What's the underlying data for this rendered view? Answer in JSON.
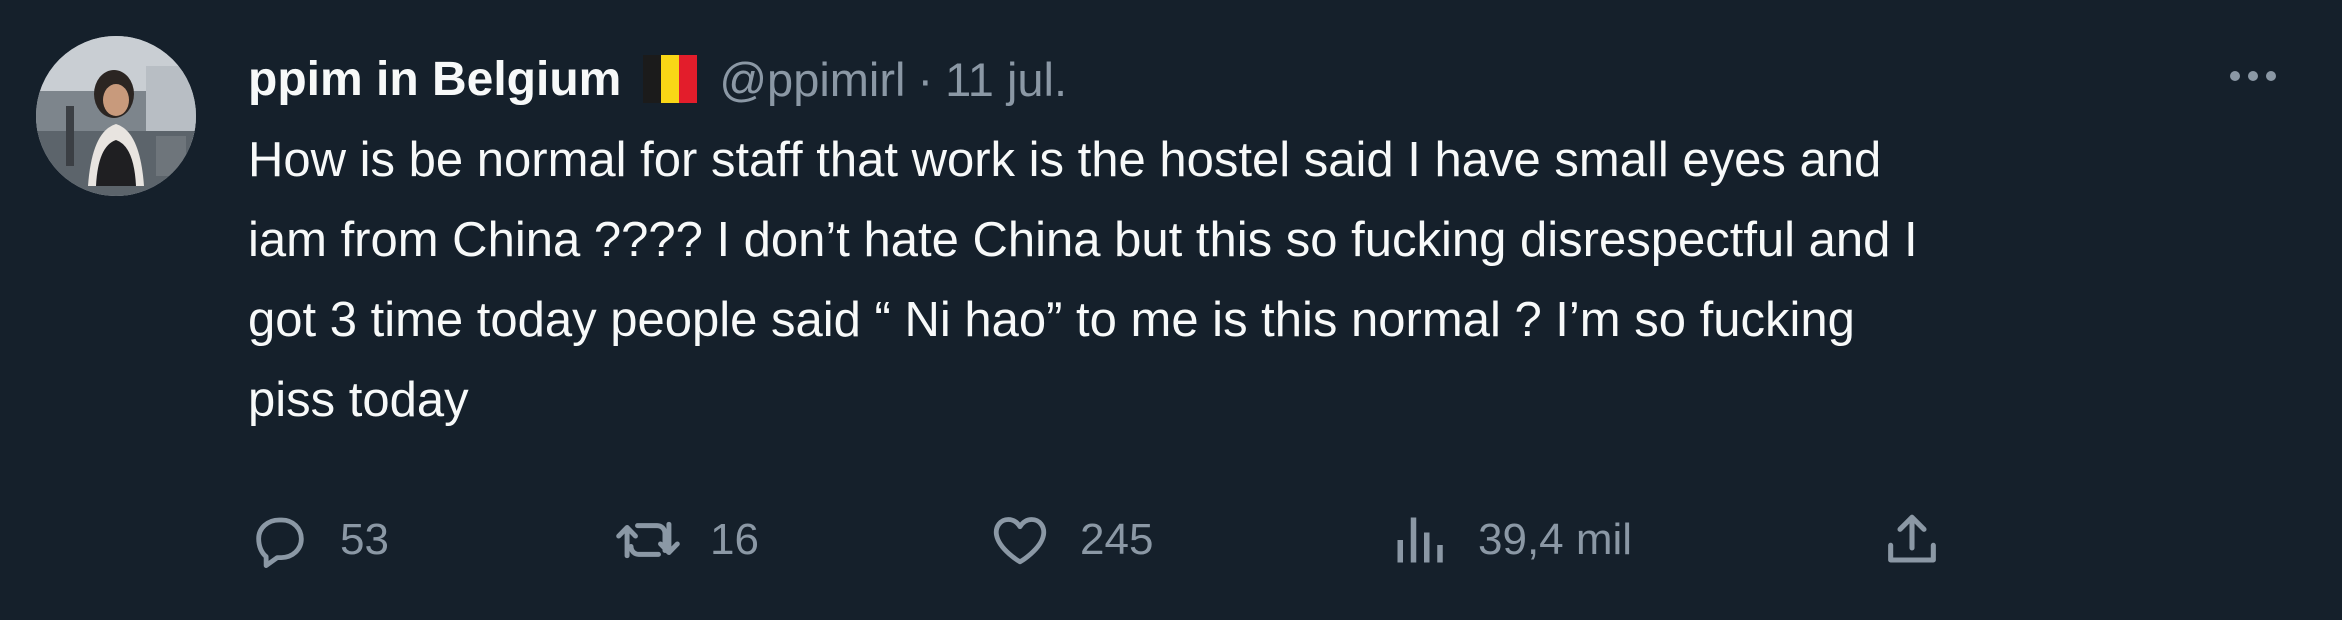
{
  "author": {
    "display_name": "ppim in Belgium",
    "flag_icon": "belgium-flag-icon",
    "flag_colors": [
      "#1b1b1b",
      "#f9d616",
      "#e31d2b"
    ],
    "handle": "@ppimirl",
    "separator": "·",
    "date": "11 jul."
  },
  "tweet": {
    "lines": [
      "How is be normal for staff that work is the hostel said I have small eyes and",
      "iam from China ???? I don’t hate China but this so fucking disrespectful and I",
      "got 3 time today people said “ Ni hao” to me is this normal ? I’m so fucking",
      "piss today"
    ]
  },
  "actions": {
    "reply": {
      "icon": "reply-icon",
      "count": "53"
    },
    "retweet": {
      "icon": "retweet-icon",
      "count": "16"
    },
    "like": {
      "icon": "heart-icon",
      "count": "245"
    },
    "views": {
      "icon": "views-icon",
      "count": "39,4 mil"
    },
    "share": {
      "icon": "share-icon"
    }
  },
  "more_icon": "more-options-icon",
  "colors": {
    "background": "#15202b",
    "primary_text": "#f7f9f9",
    "secondary_text": "#8b98a5"
  }
}
